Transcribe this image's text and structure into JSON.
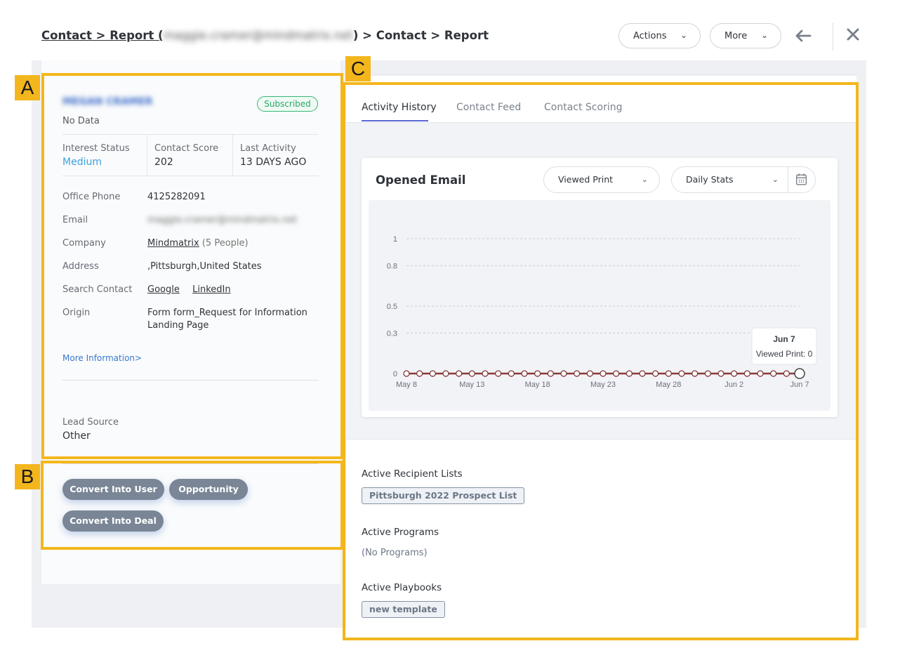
{
  "header": {
    "breadcrumb_prefix": "Contact > Report (",
    "breadcrumb_blurred": "maggie.cramer@mindmatrix.net",
    "breadcrumb_suffix": ") > Contact > Report",
    "actions_label": "Actions",
    "more_label": "More"
  },
  "annotations": {
    "a": "A",
    "b": "B",
    "c": "C"
  },
  "contact": {
    "name_blurred": "MEGAN CRAMER",
    "subscription_status": "Subscribed",
    "subtitle": "No Data",
    "stats": [
      {
        "label": "Interest Status",
        "value": "Medium"
      },
      {
        "label": "Contact Score",
        "value": "202"
      },
      {
        "label": "Last Activity",
        "value": "13 DAYS AGO"
      }
    ],
    "info": {
      "office_phone_label": "Office Phone",
      "office_phone": "4125282091",
      "email_label": "Email",
      "email_blurred": "maggie.cramer@mindmatrix.net",
      "company_label": "Company",
      "company_name": "Mindmatrix",
      "company_people": "(5 People)",
      "address_label": "Address",
      "address": ",Pittsburgh,United States",
      "search_label": "Search Contact",
      "search_google": "Google",
      "search_linkedin": "LinkedIn",
      "origin_label": "Origin",
      "origin_line1": "Form form_Request for Information",
      "origin_line2": "Landing Page"
    },
    "more_information": "More Information>",
    "lead_source_label": "Lead Source",
    "lead_source": "Other"
  },
  "actions": {
    "convert_user": "Convert Into User",
    "opportunity": "Opportunity",
    "convert_deal": "Convert Into Deal"
  },
  "tabs": [
    {
      "label": "Activity History",
      "active": true
    },
    {
      "label": "Contact Feed",
      "active": false
    },
    {
      "label": "Contact Scoring",
      "active": false
    }
  ],
  "chart_card": {
    "title": "Opened Email",
    "metric_select": "Viewed Print",
    "period_select": "Daily Stats",
    "tooltip_date": "Jun 7",
    "tooltip_value": "Viewed Print: 0"
  },
  "chart_data": {
    "type": "line",
    "title": "Opened Email",
    "xlabel": "",
    "ylabel": "",
    "ylim": [
      0,
      1
    ],
    "y_ticks": [
      "0",
      "0.3",
      "0.5",
      "0.8",
      "1"
    ],
    "x_tick_labels": [
      "May 8",
      "May 13",
      "May 18",
      "May 23",
      "May 28",
      "Jun 2",
      "Jun 7"
    ],
    "series": [
      {
        "values": [
          0,
          0,
          0,
          0,
          0,
          0,
          0,
          0,
          0,
          0,
          0,
          0,
          0,
          0,
          0,
          0,
          0,
          0,
          0,
          0,
          0,
          0,
          0,
          0,
          0,
          0,
          0,
          0,
          0,
          0,
          0
        ],
        "color": "#8b3a3a"
      }
    ],
    "grid": true,
    "legend": "none"
  },
  "sections": {
    "recipient_lists_title": "Active Recipient Lists",
    "recipient_list_tag": "Pittsburgh 2022 Prospect List",
    "programs_title": "Active Programs",
    "programs_empty": "(No Programs)",
    "playbooks_title": "Active Playbooks",
    "playbook_tag": "new template"
  },
  "colors": {
    "annotation": "#f3b71d",
    "accent_tab": "#5a68d6",
    "medium": "#3ea0df",
    "subscribed": "#2ca76b",
    "pill": "#7a8696",
    "series": "#8b3a3a"
  }
}
